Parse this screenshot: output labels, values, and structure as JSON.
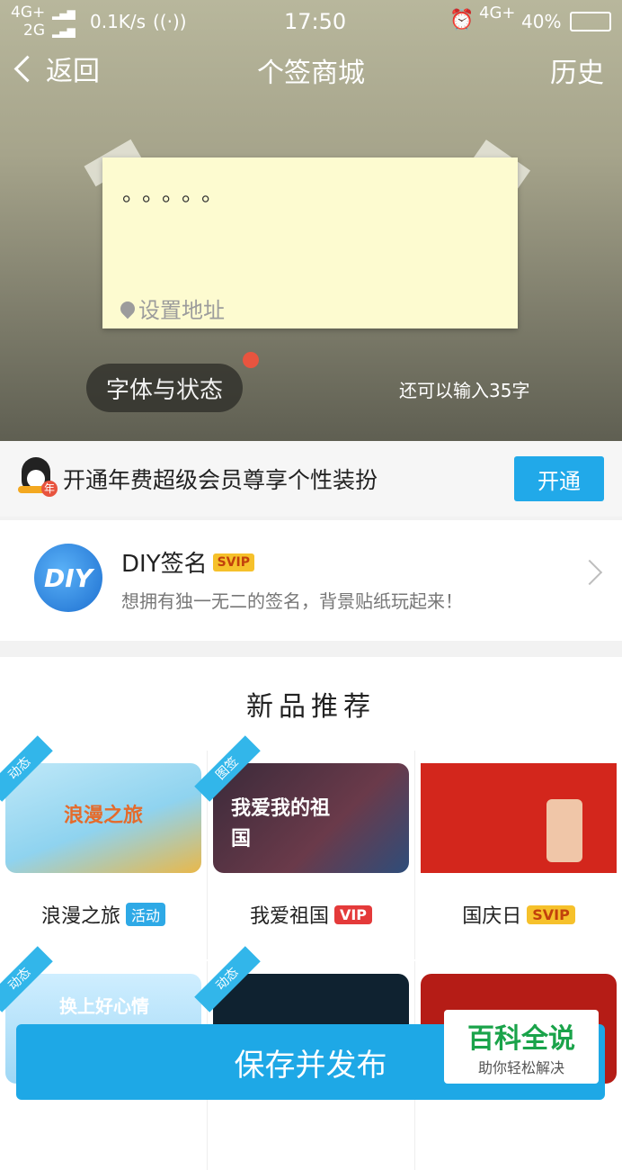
{
  "status_bar": {
    "network_1": "4G+",
    "network_2": "2G",
    "speed": "0.1K/s",
    "time": "17:50",
    "network_3": "4G+",
    "battery": "40%"
  },
  "nav": {
    "back": "返回",
    "title": "个签商城",
    "history": "历史"
  },
  "note": {
    "text": "。。。。。",
    "location": "设置地址"
  },
  "font_button": "字体与状态",
  "remaining": "还可以输入35字",
  "vip_bar": {
    "text": "开通年费超级会员尊享个性装扮",
    "button": "开通",
    "badge": "年"
  },
  "diy": {
    "logo": "DIY",
    "title": "DIY签名",
    "badge": "SVIP",
    "subtitle": "想拥有独一无二的签名，背景贴纸玩起来！"
  },
  "new_section": {
    "title": "新品推荐",
    "items": [
      {
        "name": "浪漫之旅",
        "ribbon": "动态",
        "tag": "活动",
        "img_text": "浪漫之旅"
      },
      {
        "name": "我爱祖国",
        "ribbon": "图签",
        "tag": "VIP",
        "img_text": "我爱我的祖国"
      },
      {
        "name": "国庆日",
        "ribbon": "",
        "tag": "SVIP",
        "img_text": ""
      },
      {
        "name": "",
        "ribbon": "动态",
        "tag": "",
        "img_text": "换上好心情"
      },
      {
        "name": "",
        "ribbon": "动态",
        "tag": "",
        "img_text": ""
      },
      {
        "name": "",
        "ribbon": "",
        "tag": "",
        "img_text": ""
      }
    ]
  },
  "save_button": "保存并发布",
  "watermark": {
    "title": "百科全说",
    "subtitle": "助你轻松解决"
  }
}
